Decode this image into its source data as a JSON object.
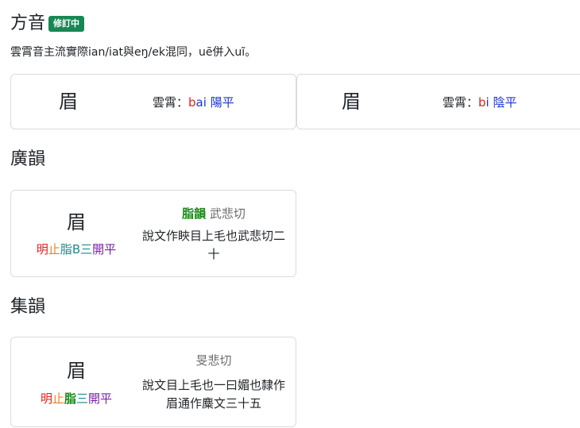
{
  "fangyin": {
    "title": "方音",
    "badge": "修訂中",
    "note": "雲霄音主流實際ian/iat與eŋ/ek混同，uẽ併入uĩ。",
    "cards": [
      {
        "char": "眉",
        "label": "雲霄：",
        "initial": "b",
        "final": "ai",
        "tone": "陽平"
      },
      {
        "char": "眉",
        "label": "雲霄：",
        "initial": "b",
        "final": "i",
        "tone": "陰平"
      }
    ]
  },
  "guangyun": {
    "title": "廣韻",
    "card": {
      "char": "眉",
      "pos": {
        "initial": "明",
        "kai": "止",
        "rhyme": "脂B",
        "grade": "三",
        "openness": "開",
        "tone": "平"
      },
      "rhyme_name": "脂韻",
      "fanqie": "武悲切",
      "gloss": "說文作䀹目上毛也武悲切二十"
    }
  },
  "jiyun": {
    "title": "集韻",
    "card": {
      "char": "眉",
      "pos": {
        "initial": "明",
        "kai": "止",
        "rhyme": "脂",
        "grade": "三",
        "openness": "開",
        "tone": "平"
      },
      "fanqie": "旻悲切",
      "gloss": "說文目上毛也一曰媚也隸作眉通作麋文三十五"
    }
  }
}
